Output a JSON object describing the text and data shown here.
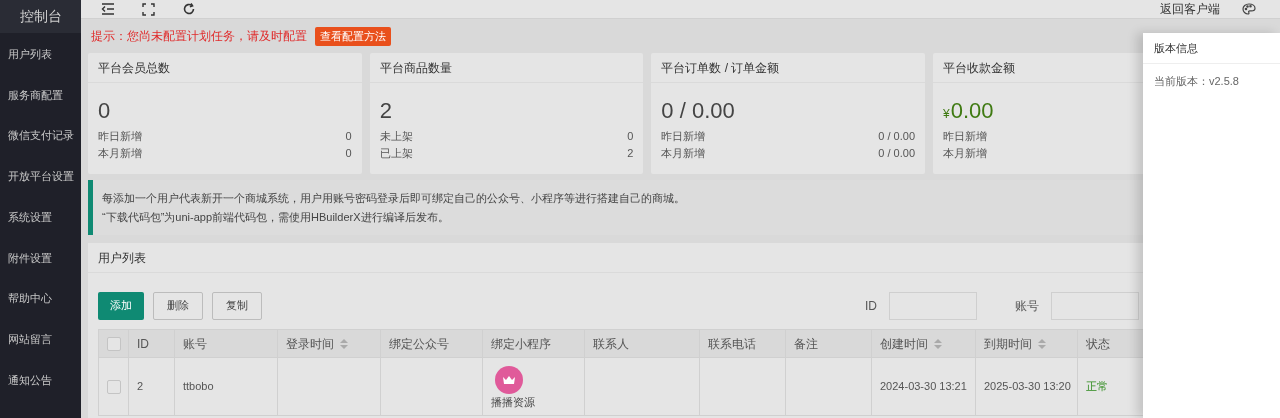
{
  "sidebar": {
    "title": "控制台",
    "items": [
      {
        "label": "用户列表",
        "selected": false
      },
      {
        "label": "服务商配置",
        "selected": false
      },
      {
        "label": "微信支付记录",
        "selected": false
      },
      {
        "label": "开放平台设置",
        "selected": false
      },
      {
        "label": "系统设置",
        "selected": false
      },
      {
        "label": "附件设置",
        "selected": false
      },
      {
        "label": "帮助中心",
        "selected": false
      },
      {
        "label": "网站留言",
        "selected": false
      },
      {
        "label": "通知公告",
        "selected": false
      }
    ]
  },
  "topbar": {
    "link": "返回客户端"
  },
  "notice": {
    "text": "提示：您尚未配置计划任务，请及时配置",
    "button": "查看配置方法"
  },
  "cards": [
    {
      "kind": "count",
      "title": "平台会员总数",
      "value": "0",
      "rows": [
        {
          "label": "昨日新增",
          "value": "0"
        },
        {
          "label": "本月新增",
          "value": "0"
        }
      ]
    },
    {
      "kind": "count",
      "title": "平台商品数量",
      "value": "2",
      "rows": [
        {
          "label": "未上架",
          "value": "0"
        },
        {
          "label": "已上架",
          "value": "2"
        }
      ]
    },
    {
      "kind": "count",
      "title": "平台订单数 / 订单金额",
      "value": "0 / 0.00",
      "rows": [
        {
          "label": "昨日新增",
          "value": "0 / 0.00"
        },
        {
          "label": "本月新增",
          "value": "0 / 0.00"
        }
      ]
    },
    {
      "kind": "money",
      "title": "平台收款金额",
      "currency": "¥",
      "value": "0.00",
      "rows": [
        {
          "label": "昨日新增"
        },
        {
          "label": "本月新增"
        }
      ]
    }
  ],
  "info": [
    "每添加一个用户代表新开一个商城系统，用户用账号密码登录后即可绑定自己的公众号、小程序等进行搭建自己的商城。",
    "“下载代码包”为uni-app前端代码包，需使用HBuilderX进行编译后发布。"
  ],
  "table_panel": {
    "title": "用户列表",
    "buttons": [
      {
        "label": "添加",
        "kind": "primary"
      },
      {
        "label": "删除",
        "kind": "plain"
      },
      {
        "label": "复制",
        "kind": "plain"
      }
    ],
    "filters": [
      {
        "label": "ID"
      },
      {
        "label": "账号"
      }
    ],
    "select_all_checked": false,
    "columns": [
      {
        "label": "ID",
        "sortable": false
      },
      {
        "label": "账号",
        "sortable": false
      },
      {
        "label": "登录时间",
        "sortable": true
      },
      {
        "label": "绑定公众号",
        "sortable": false
      },
      {
        "label": "绑定小程序",
        "sortable": false
      },
      {
        "label": "联系人",
        "sortable": false
      },
      {
        "label": "联系电话",
        "sortable": false
      },
      {
        "label": "备注",
        "sortable": false
      },
      {
        "label": "创建时间",
        "sortable": true
      },
      {
        "label": "到期时间",
        "sortable": true
      },
      {
        "label": "状态",
        "sortable": false
      }
    ],
    "rows": [
      {
        "checked": false,
        "id": "2",
        "account": "ttbobo",
        "miniprogram": "播播资源",
        "created": "2024-03-30 13:21",
        "expires": "2025-03-30 13:20",
        "status": "正常"
      }
    ]
  },
  "drawer": {
    "title": "版本信息",
    "text": "当前版本：v2.5.8"
  }
}
